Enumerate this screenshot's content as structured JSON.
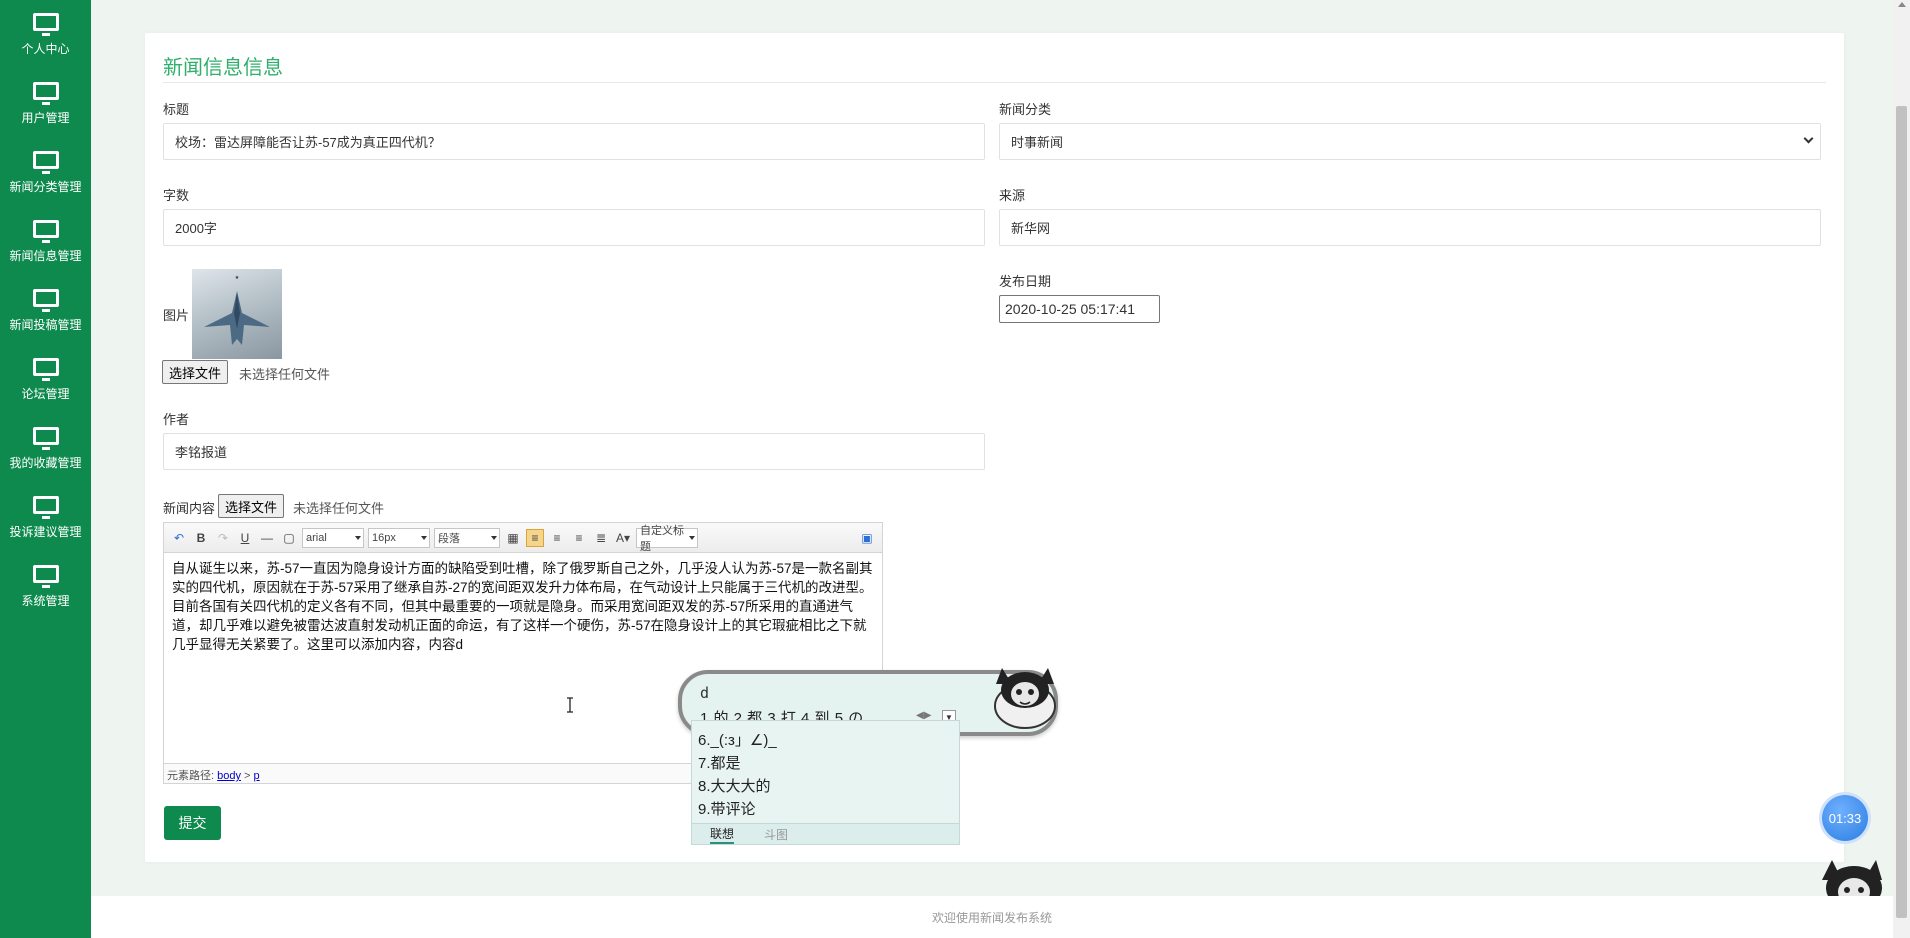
{
  "sidebar": {
    "items": [
      {
        "label": "个人中心",
        "icon": "monitor-icon"
      },
      {
        "label": "用户管理",
        "icon": "monitor-icon"
      },
      {
        "label": "新闻分类管理",
        "icon": "monitor-icon"
      },
      {
        "label": "新闻信息管理",
        "icon": "monitor-icon"
      },
      {
        "label": "新闻投稿管理",
        "icon": "monitor-icon"
      },
      {
        "label": "论坛管理",
        "icon": "monitor-icon"
      },
      {
        "label": "我的收藏管理",
        "icon": "monitor-icon"
      },
      {
        "label": "投诉建议管理",
        "icon": "monitor-icon"
      },
      {
        "label": "系统管理",
        "icon": "monitor-icon"
      }
    ]
  },
  "form": {
    "title": "新闻信息信息",
    "title_label": "标题",
    "title_value": "校场：雷达屏障能否让苏-57成为真正四代机？",
    "category_label": "新闻分类",
    "category_value": "时事新闻",
    "wordcount_label": "字数",
    "wordcount_value": "2000字",
    "source_label": "来源",
    "source_value": "新华网",
    "image_label": "图片",
    "file_button": "选择文件",
    "file_none": "未选择任何文件",
    "date_label": "发布日期",
    "date_value": "2020-10-25 05:17:41",
    "author_label": "作者",
    "author_value": "李铭报道",
    "content_label": "新闻内容",
    "submit": "提交"
  },
  "editor": {
    "font": "arial",
    "size": "16px",
    "paragraph": "段落",
    "custom_title": "自定义标题",
    "content": "自从诞生以来，苏-57一直因为隐身设计方面的缺陷受到吐槽，除了俄罗斯自己之外，几乎没人认为苏-57是一款名副其实的四代机，原因就在于苏-57采用了继承自苏-27的宽间距双发升力体布局，在气动设计上只能属于三代机的改进型。目前各国有关四代机的定义各有不同，但其中最重要的一项就是隐身。而采用宽间距双发的苏-57所采用的直通进气道，却几乎难以避免被雷达波直射发动机正面的命运，有了这样一个硬伤，苏-57在隐身设计上的其它瑕疵相比之下就几乎显得无关紧要了。这里可以添加内容，内容d",
    "path_label": "元素路径:",
    "path_body": "body",
    "path_sep": ">",
    "path_p": "p"
  },
  "ime": {
    "pinyin": "d",
    "row": "1.的  2.都  3.打  4.到  5.の",
    "list": [
      "6._(:з」∠)_",
      "7.都是",
      "8.大大大的",
      "9.带评论"
    ],
    "tab_active": "联想",
    "tab_inactive": "斗图"
  },
  "timer": "01:33",
  "footer": "欢迎使用新闻发布系统",
  "colors": {
    "brand": "#0e8a4e",
    "title": "#2eaf6b"
  }
}
